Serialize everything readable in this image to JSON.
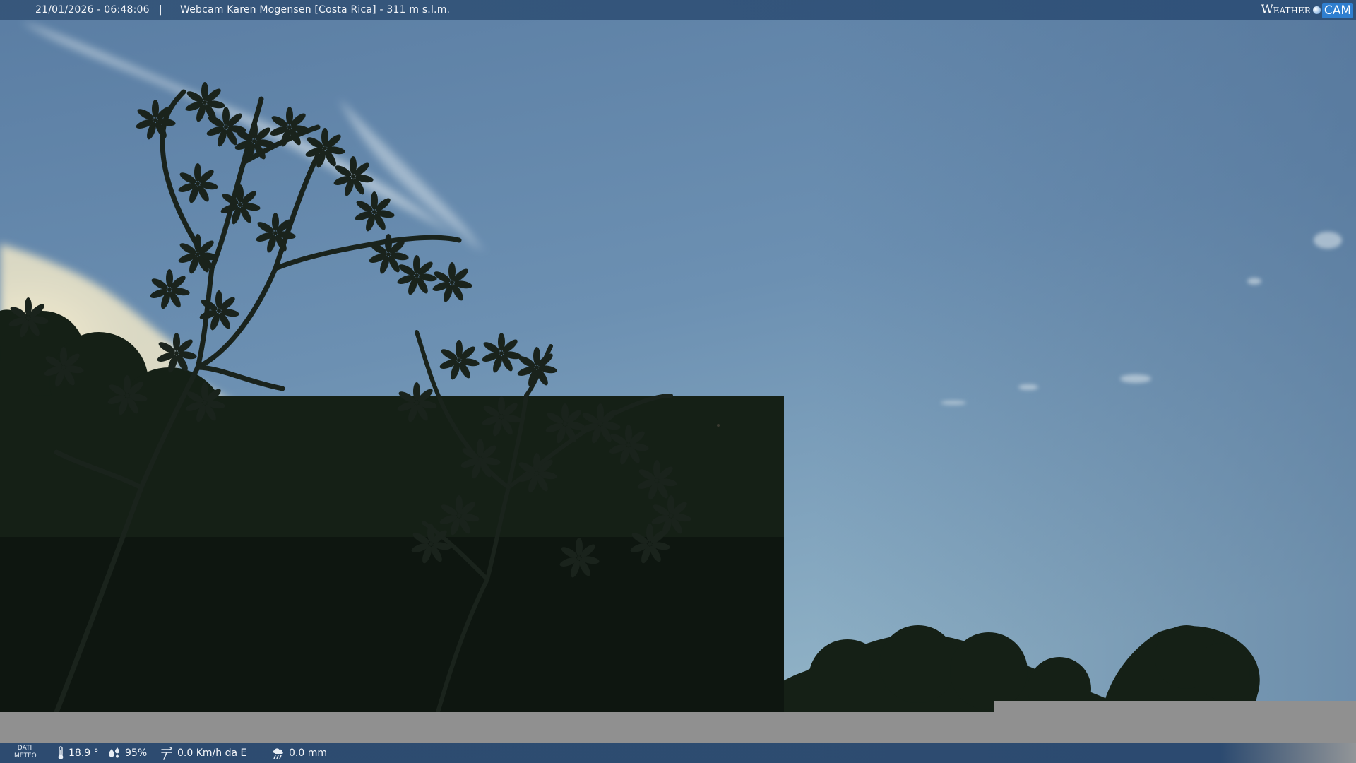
{
  "header": {
    "datetime": "21/01/2026 - 06:48:06",
    "separator": "|",
    "title": "Webcam Karen Mogensen [Costa Rica]  - 311 m s.l.m."
  },
  "logo": {
    "weather": "Weather",
    "cam": "CAM"
  },
  "footer": {
    "dati_line1": "DATI",
    "dati_line2": "METEO",
    "temperature": "18.9 °",
    "humidity": "95%",
    "wind": "0.0 Km/h da E",
    "rain": "0.0 mm"
  },
  "icons": {
    "temperature": "thermometer-icon",
    "humidity": "droplets-icon",
    "wind": "wind-icon",
    "rain": "rain-cloud-icon"
  },
  "colors": {
    "sky_top": "#5d7fa2",
    "sky_bottom": "#8fb0c4",
    "bar": "#2c4e76",
    "band": "#909090",
    "foliage": "#152016"
  }
}
